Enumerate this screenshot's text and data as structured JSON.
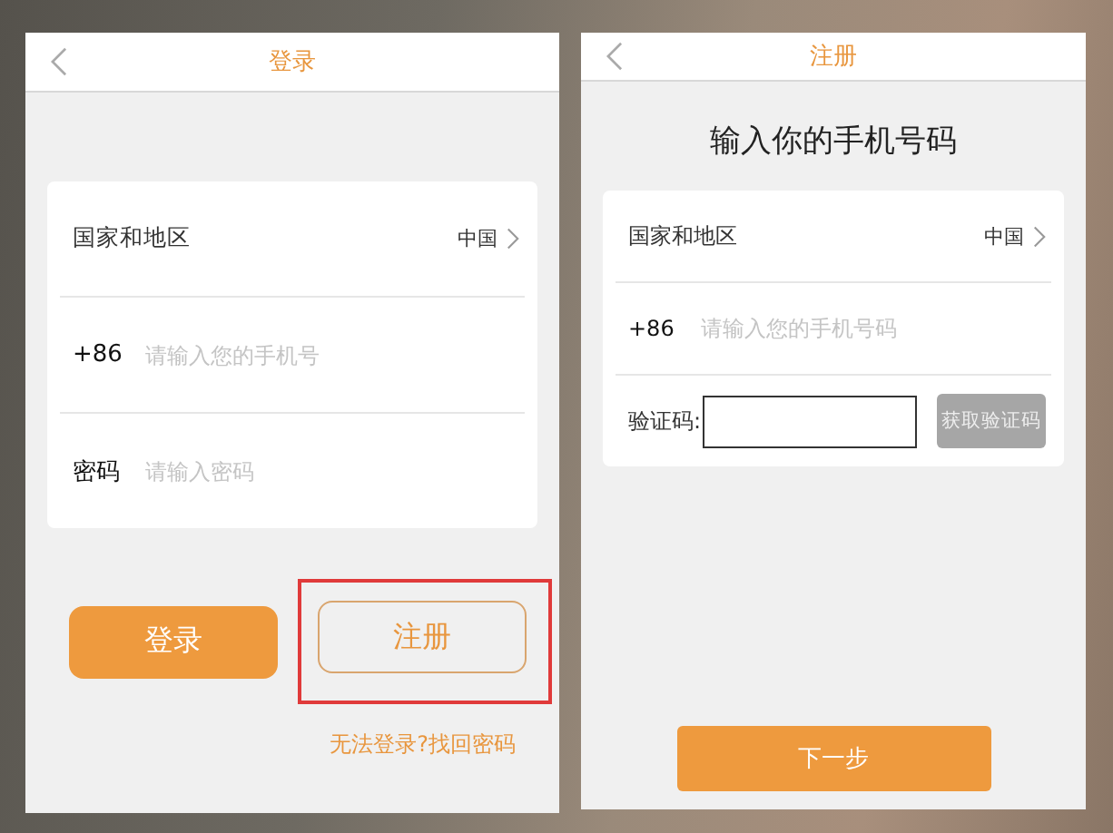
{
  "screens": [
    {
      "kind": "login",
      "title": "登录",
      "form": [
        {
          "kind": "select",
          "label": "国家和地区",
          "value": "中国"
        },
        {
          "kind": "input",
          "label": "+86",
          "placeholder": "请输入您的手机号"
        },
        {
          "kind": "input",
          "label": "密码",
          "placeholder": "请输入密码"
        }
      ],
      "buttons": [
        {
          "label": "登录",
          "kind": "filled",
          "highlighted": false
        },
        {
          "label": "注册",
          "kind": "outline",
          "highlighted": true
        }
      ],
      "link": "无法登录?找回密码"
    },
    {
      "kind": "register",
      "title": "注册",
      "heading": "输入你的手机号码",
      "form": [
        {
          "kind": "select",
          "label": "国家和地区",
          "value": "中国"
        },
        {
          "kind": "input",
          "label": "+86",
          "placeholder": "请输入您的手机号码"
        },
        {
          "kind": "code",
          "label": "验证码:",
          "button": "获取验证码",
          "disabled": true
        }
      ],
      "buttons": [
        {
          "label": "下一步",
          "kind": "filled",
          "highlighted": false
        }
      ]
    }
  ]
}
